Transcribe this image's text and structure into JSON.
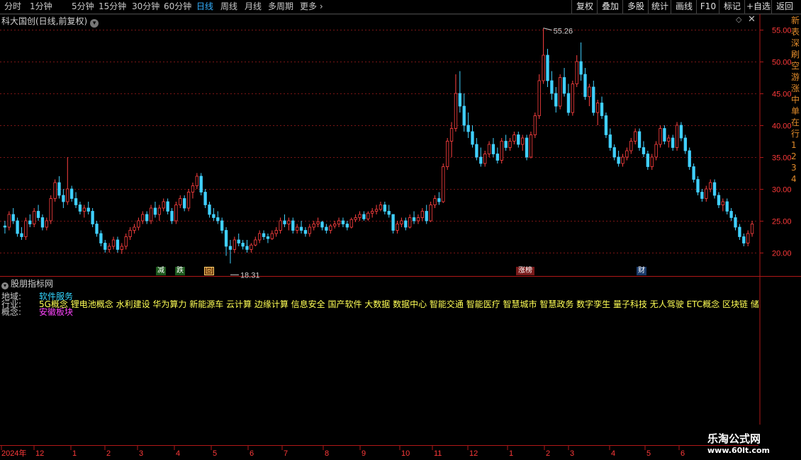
{
  "toolbar": {
    "periods": [
      "分时",
      "1分钟",
      "5分钟",
      "15分钟",
      "30分钟",
      "60分钟",
      "日线",
      "周线",
      "月线",
      "多周期",
      "更多"
    ],
    "active_period": "日线",
    "right_buttons": [
      "复权",
      "叠加",
      "多股",
      "统计",
      "画线",
      "F10",
      "标记",
      "+自选",
      "返回"
    ]
  },
  "chart": {
    "title": "科大国创(日线,前复权)",
    "high_label": "55.26",
    "low_label": "18.31",
    "price_ticks": [
      "55.00",
      "50.00",
      "45.00",
      "40.00",
      "35.00",
      "30.00",
      "25.00",
      "20.00"
    ],
    "up_color": "#ff4040",
    "down_color": "#40d0ff",
    "ma_visible": false
  },
  "signals": [
    {
      "text": "减",
      "style": "green"
    },
    {
      "text": "跌",
      "style": "green"
    },
    {
      "text": "回",
      "style": "orange"
    },
    {
      "text": "涨榜",
      "style": "red"
    },
    {
      "text": "财",
      "style": "blue"
    }
  ],
  "indicator": {
    "title": "股朋指标网",
    "rows": [
      {
        "label": "地域:",
        "value": "软件服务",
        "color": "cyan"
      },
      {
        "label": "行业:",
        "value": "5G概念 锂电池概念 水利建设 华为算力 新能源车 云计算 边缘计算 信息安全 国产软件 大数据 数据中心 智能交通 智能医疗 智慧城市 智慧政务 数字孪生 量子科技 无人驾驶 ETC概念 区块链 储能 ",
        "color": "yellow"
      },
      {
        "label": "概念:",
        "value": "安徽板块",
        "color": "magenta"
      }
    ]
  },
  "time_axis": {
    "labels": [
      "2024年",
      "12",
      "1",
      "2",
      "3",
      "4",
      "5",
      "6",
      "7",
      "8",
      "9",
      "10",
      "11",
      "12",
      "1",
      "2",
      "3",
      "4",
      "5",
      "6"
    ]
  },
  "right_strip_text": [
    "新",
    "表",
    "深",
    "刷",
    "空",
    "游",
    "涨",
    "中",
    "单",
    "在",
    "行",
    "1",
    "2",
    "3",
    "4"
  ],
  "watermark": {
    "title": "乐淘公式网",
    "url": "www.60lt.com"
  },
  "ohlc": [
    [
      24.2,
      25.0,
      23.0,
      24.0
    ],
    [
      24.0,
      26.5,
      23.5,
      26.0
    ],
    [
      26.0,
      27.0,
      24.5,
      25.0
    ],
    [
      25.0,
      25.5,
      22.5,
      23.0
    ],
    [
      23.0,
      24.0,
      22.0,
      22.5
    ],
    [
      22.5,
      25.5,
      22.0,
      25.0
    ],
    [
      25.0,
      26.0,
      24.0,
      24.5
    ],
    [
      24.5,
      27.0,
      24.0,
      26.5
    ],
    [
      26.5,
      27.5,
      25.0,
      25.5
    ],
    [
      25.5,
      26.0,
      23.5,
      24.0
    ],
    [
      24.0,
      25.5,
      23.5,
      25.0
    ],
    [
      25.0,
      29.0,
      24.5,
      28.5
    ],
    [
      28.5,
      31.5,
      28.0,
      31.0
    ],
    [
      31.0,
      32.0,
      28.5,
      29.0
    ],
    [
      29.0,
      30.0,
      27.0,
      28.0
    ],
    [
      28.0,
      35.0,
      27.5,
      30.0
    ],
    [
      30.0,
      30.5,
      28.0,
      28.5
    ],
    [
      28.5,
      29.5,
      27.0,
      27.5
    ],
    [
      27.5,
      28.0,
      26.0,
      26.5
    ],
    [
      26.5,
      27.5,
      25.5,
      27.0
    ],
    [
      27.0,
      28.0,
      26.0,
      26.5
    ],
    [
      26.5,
      27.0,
      24.0,
      24.5
    ],
    [
      24.5,
      25.0,
      22.5,
      23.0
    ],
    [
      23.0,
      23.5,
      21.0,
      21.5
    ],
    [
      21.5,
      22.0,
      20.0,
      20.5
    ],
    [
      20.5,
      21.5,
      20.0,
      21.0
    ],
    [
      21.0,
      22.5,
      20.5,
      22.0
    ],
    [
      22.0,
      22.5,
      20.0,
      20.5
    ],
    [
      20.5,
      21.5,
      19.8,
      21.0
    ],
    [
      21.0,
      23.0,
      20.5,
      22.5
    ],
    [
      22.5,
      24.0,
      22.0,
      23.5
    ],
    [
      23.5,
      24.5,
      23.0,
      24.0
    ],
    [
      24.0,
      25.5,
      23.5,
      25.0
    ],
    [
      25.0,
      26.5,
      24.5,
      26.0
    ],
    [
      26.0,
      26.5,
      24.5,
      25.0
    ],
    [
      25.0,
      27.5,
      24.5,
      27.0
    ],
    [
      27.0,
      28.0,
      25.5,
      26.0
    ],
    [
      26.0,
      27.5,
      25.0,
      27.0
    ],
    [
      27.0,
      28.5,
      26.5,
      28.0
    ],
    [
      28.0,
      28.5,
      26.0,
      26.5
    ],
    [
      26.5,
      27.0,
      24.5,
      25.0
    ],
    [
      25.0,
      28.0,
      24.5,
      27.5
    ],
    [
      27.5,
      29.0,
      27.0,
      28.5
    ],
    [
      28.5,
      29.0,
      26.5,
      27.0
    ],
    [
      27.0,
      30.0,
      26.5,
      29.5
    ],
    [
      29.5,
      31.0,
      28.5,
      30.5
    ],
    [
      30.5,
      32.5,
      30.0,
      32.0
    ],
    [
      32.0,
      32.5,
      29.0,
      29.5
    ],
    [
      29.5,
      30.0,
      27.0,
      27.5
    ],
    [
      27.5,
      28.0,
      25.5,
      26.0
    ],
    [
      26.0,
      27.0,
      25.0,
      25.5
    ],
    [
      25.5,
      26.5,
      24.5,
      25.0
    ],
    [
      25.0,
      25.5,
      23.0,
      23.5
    ],
    [
      23.5,
      24.0,
      19.5,
      21.0
    ],
    [
      21.0,
      22.0,
      18.3,
      20.5
    ],
    [
      20.5,
      22.5,
      20.0,
      22.0
    ],
    [
      22.0,
      23.0,
      21.0,
      21.5
    ],
    [
      21.5,
      22.0,
      20.5,
      21.0
    ],
    [
      21.0,
      22.0,
      20.0,
      20.5
    ],
    [
      20.5,
      21.5,
      20.0,
      21.2
    ],
    [
      21.2,
      22.5,
      21.0,
      22.0
    ],
    [
      22.0,
      23.5,
      21.5,
      23.0
    ],
    [
      23.0,
      23.5,
      22.0,
      22.5
    ],
    [
      22.5,
      23.0,
      21.5,
      22.2
    ],
    [
      22.2,
      23.5,
      22.0,
      23.0
    ],
    [
      23.0,
      24.0,
      22.5,
      23.5
    ],
    [
      23.5,
      25.5,
      23.0,
      25.0
    ],
    [
      25.0,
      26.0,
      24.0,
      24.5
    ],
    [
      24.5,
      25.5,
      23.5,
      25.0
    ],
    [
      25.0,
      25.5,
      23.0,
      23.5
    ],
    [
      23.5,
      24.5,
      23.0,
      24.0
    ],
    [
      24.0,
      25.0,
      23.0,
      23.5
    ],
    [
      23.5,
      24.0,
      22.5,
      23.0
    ],
    [
      23.0,
      24.5,
      22.5,
      24.0
    ],
    [
      24.0,
      25.0,
      23.5,
      24.5
    ],
    [
      24.5,
      25.5,
      24.0,
      24.8
    ],
    [
      24.8,
      25.0,
      23.5,
      24.0
    ],
    [
      24.0,
      24.5,
      23.0,
      23.5
    ],
    [
      23.5,
      24.5,
      23.0,
      24.2
    ],
    [
      24.2,
      25.0,
      23.8,
      24.5
    ],
    [
      24.5,
      25.5,
      24.0,
      25.0
    ],
    [
      25.0,
      25.5,
      24.0,
      24.5
    ],
    [
      24.5,
      25.0,
      23.5,
      24.0
    ],
    [
      24.0,
      25.5,
      23.8,
      25.2
    ],
    [
      25.2,
      26.0,
      24.8,
      25.5
    ],
    [
      25.5,
      26.5,
      25.0,
      26.0
    ],
    [
      26.0,
      26.5,
      25.0,
      25.3
    ],
    [
      25.3,
      26.5,
      25.0,
      26.2
    ],
    [
      26.2,
      27.0,
      25.5,
      26.5
    ],
    [
      26.5,
      27.5,
      26.0,
      26.8
    ],
    [
      26.8,
      28.0,
      26.5,
      27.5
    ],
    [
      27.5,
      28.0,
      26.0,
      26.5
    ],
    [
      26.5,
      27.5,
      25.5,
      26.0
    ],
    [
      26.0,
      25.5,
      23.0,
      23.5
    ],
    [
      23.5,
      25.0,
      23.0,
      24.5
    ],
    [
      24.5,
      25.5,
      24.0,
      25.0
    ],
    [
      25.0,
      25.5,
      23.5,
      24.0
    ],
    [
      24.0,
      26.0,
      23.8,
      25.5
    ],
    [
      25.5,
      26.5,
      24.5,
      25.0
    ],
    [
      25.0,
      26.0,
      24.5,
      25.5
    ],
    [
      25.5,
      27.0,
      25.0,
      26.5
    ],
    [
      26.5,
      27.5,
      24.5,
      25.0
    ],
    [
      25.0,
      28.0,
      24.8,
      27.5
    ],
    [
      27.5,
      29.0,
      27.0,
      28.5
    ],
    [
      28.5,
      29.5,
      27.5,
      28.0
    ],
    [
      28.0,
      34.0,
      27.8,
      33.5
    ],
    [
      33.5,
      38.0,
      33.0,
      37.5
    ],
    [
      37.5,
      40.5,
      35.0,
      39.5
    ],
    [
      39.5,
      48.0,
      39.0,
      45.0
    ],
    [
      45.0,
      48.5,
      42.0,
      43.0
    ],
    [
      43.0,
      45.0,
      39.0,
      40.0
    ],
    [
      40.0,
      42.0,
      38.0,
      39.0
    ],
    [
      39.0,
      40.0,
      36.5,
      37.0
    ],
    [
      37.0,
      38.0,
      34.5,
      35.0
    ],
    [
      35.0,
      36.5,
      33.5,
      34.0
    ],
    [
      34.0,
      36.0,
      33.5,
      35.5
    ],
    [
      35.5,
      37.5,
      35.0,
      37.0
    ],
    [
      37.0,
      38.0,
      35.0,
      35.5
    ],
    [
      35.5,
      36.5,
      34.0,
      34.5
    ],
    [
      34.5,
      38.0,
      34.0,
      37.5
    ],
    [
      37.5,
      38.5,
      36.0,
      36.5
    ],
    [
      36.5,
      38.0,
      36.0,
      37.5
    ],
    [
      37.5,
      39.0,
      37.0,
      38.5
    ],
    [
      38.5,
      39.0,
      36.5,
      37.0
    ],
    [
      37.0,
      38.5,
      36.0,
      38.0
    ],
    [
      38.0,
      38.5,
      34.5,
      35.0
    ],
    [
      35.0,
      39.0,
      34.8,
      38.5
    ],
    [
      38.5,
      42.0,
      38.0,
      41.5
    ],
    [
      41.5,
      48.0,
      41.0,
      47.0
    ],
    [
      47.0,
      55.26,
      46.5,
      51.0
    ],
    [
      51.0,
      52.0,
      46.0,
      47.0
    ],
    [
      47.0,
      48.5,
      44.0,
      45.0
    ],
    [
      45.0,
      46.0,
      42.0,
      43.0
    ],
    [
      43.0,
      48.0,
      42.5,
      47.5
    ],
    [
      47.5,
      49.0,
      44.5,
      45.0
    ],
    [
      45.0,
      46.5,
      41.5,
      42.0
    ],
    [
      42.0,
      47.0,
      41.5,
      46.5
    ],
    [
      46.5,
      51.0,
      46.0,
      50.0
    ],
    [
      50.0,
      53.0,
      47.0,
      48.0
    ],
    [
      48.0,
      49.0,
      44.0,
      44.5
    ],
    [
      44.5,
      46.5,
      43.0,
      46.0
    ],
    [
      46.0,
      47.0,
      41.5,
      42.0
    ],
    [
      42.0,
      44.0,
      40.0,
      43.5
    ],
    [
      43.5,
      44.5,
      41.0,
      41.5
    ],
    [
      41.5,
      42.0,
      38.0,
      38.5
    ],
    [
      38.5,
      39.5,
      36.0,
      36.5
    ],
    [
      36.5,
      37.0,
      34.5,
      35.0
    ],
    [
      35.0,
      36.0,
      33.5,
      34.0
    ],
    [
      34.0,
      35.5,
      33.5,
      35.0
    ],
    [
      35.0,
      36.5,
      34.5,
      36.0
    ],
    [
      36.0,
      38.0,
      35.5,
      37.5
    ],
    [
      37.5,
      39.5,
      37.0,
      39.0
    ],
    [
      39.0,
      39.5,
      36.0,
      36.5
    ],
    [
      36.5,
      37.5,
      35.0,
      35.5
    ],
    [
      35.5,
      36.0,
      33.0,
      33.5
    ],
    [
      33.5,
      35.5,
      33.0,
      35.0
    ],
    [
      35.0,
      37.5,
      34.5,
      37.0
    ],
    [
      37.0,
      40.0,
      36.5,
      39.5
    ],
    [
      39.5,
      40.0,
      37.0,
      37.5
    ],
    [
      37.5,
      38.5,
      36.5,
      38.0
    ],
    [
      38.0,
      38.5,
      36.0,
      36.5
    ],
    [
      36.5,
      40.5,
      36.0,
      40.0
    ],
    [
      40.0,
      40.5,
      37.5,
      38.0
    ],
    [
      38.0,
      38.5,
      35.5,
      36.0
    ],
    [
      36.0,
      36.5,
      33.0,
      33.5
    ],
    [
      33.5,
      34.0,
      31.0,
      31.5
    ],
    [
      31.5,
      32.0,
      29.0,
      29.5
    ],
    [
      29.5,
      30.0,
      28.0,
      28.5
    ],
    [
      28.5,
      30.5,
      28.0,
      30.0
    ],
    [
      30.0,
      31.5,
      29.5,
      31.0
    ],
    [
      31.0,
      31.5,
      28.5,
      29.0
    ],
    [
      29.0,
      29.5,
      27.0,
      27.5
    ],
    [
      27.5,
      28.5,
      26.5,
      28.0
    ],
    [
      28.0,
      28.5,
      26.0,
      26.5
    ],
    [
      26.5,
      27.0,
      25.0,
      25.5
    ],
    [
      25.5,
      26.0,
      23.5,
      24.0
    ],
    [
      24.0,
      24.5,
      22.0,
      22.5
    ],
    [
      22.5,
      23.0,
      21.0,
      21.5
    ],
    [
      21.5,
      23.5,
      21.0,
      23.0
    ],
    [
      23.0,
      25.0,
      22.5,
      24.5
    ]
  ]
}
